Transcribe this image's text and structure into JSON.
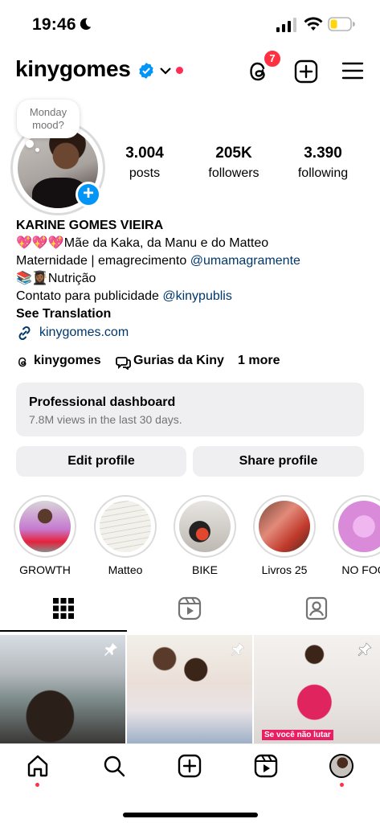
{
  "status_bar": {
    "time": "19:46",
    "moon_icon": "moon-icon",
    "signal_icon": "cellular-signal-icon",
    "wifi_icon": "wifi-icon",
    "battery_icon": "battery-low-icon",
    "battery_color": "#ffd60a"
  },
  "header": {
    "username": "kinygomes",
    "verified_icon": "verified-badge-icon",
    "dropdown_icon": "chevron-down-icon",
    "threads_badge_count": "7",
    "accent_red": "#ff3040",
    "brand_blue": "#0095f6"
  },
  "profile": {
    "note": "Monday mood?",
    "stats": [
      {
        "value": "3.004",
        "label": "posts"
      },
      {
        "value": "205K",
        "label": "followers"
      },
      {
        "value": "3.390",
        "label": "following"
      }
    ],
    "full_name": "KARINE GOMES VIEIRA",
    "bio_line1": "💖💖💖Mãe da Kaka, da Manu e do Matteo",
    "bio_line2_text": "Maternidade | emagrecimento ",
    "bio_line2_mention": "@umamagramente",
    "bio_line3": "📚👩🏾‍🎓Nutrição",
    "bio_line4_text": "Contato para publicidade ",
    "bio_line4_mention": "@kinypublis",
    "see_translation": "See Translation",
    "website": "kinygomes.com",
    "chips": {
      "threads": "kinygomes",
      "channel": "Gurias da Kiny",
      "more": "1 more"
    }
  },
  "dashboard": {
    "title": "Professional dashboard",
    "subtitle": "7.8M views in the last 30 days."
  },
  "buttons": {
    "edit": "Edit profile",
    "share": "Share profile"
  },
  "highlights": [
    {
      "label": "GROWTH"
    },
    {
      "label": "Matteo"
    },
    {
      "label": "BIKE"
    },
    {
      "label": "Livros 25"
    },
    {
      "label": "NO FOO"
    }
  ],
  "tabs": [
    "grid-icon",
    "reels-icon",
    "tagged-icon"
  ],
  "grid": {
    "caption_3": "Se você não lutar"
  },
  "bottom_nav": [
    "home-icon",
    "search-icon",
    "create-icon",
    "reels-icon",
    "profile-avatar"
  ]
}
